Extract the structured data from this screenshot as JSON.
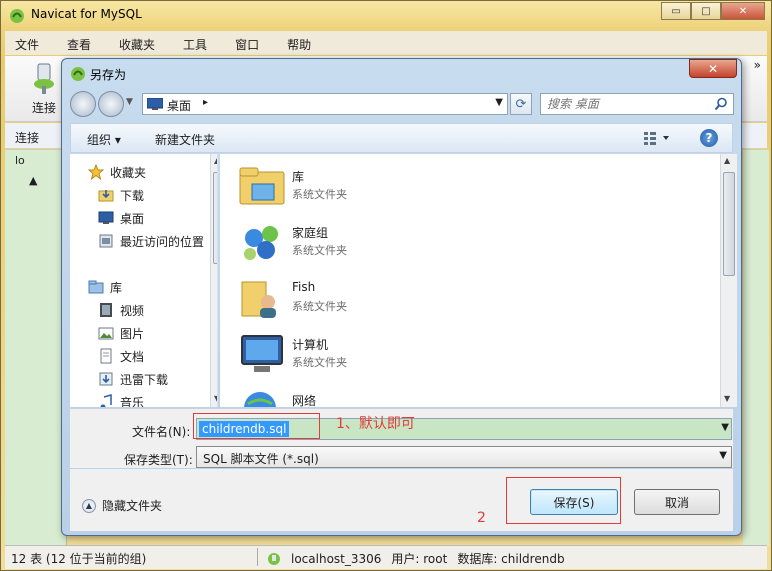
{
  "main_window": {
    "title": "Navicat for MySQL",
    "menu": [
      "文件",
      "查看",
      "收藏夹",
      "工具",
      "窗口",
      "帮助"
    ],
    "toolbar_connect": "连接",
    "more_chevron": "»",
    "subbar_label": "连接",
    "tree_items": [
      "lo",
      "▲"
    ],
    "status_left": "12 表 (12 位于当前的组)",
    "status_host": "localhost_3306",
    "status_user": "用户: root",
    "status_db": "数据库: childrendb",
    "controls": {
      "minimize": "▭",
      "maximize": "□",
      "close": "✕"
    }
  },
  "dialog": {
    "title": "另存为",
    "close": "✕",
    "address": {
      "location": "桌面",
      "separator": "▸"
    },
    "search_placeholder": "搜索 桌面",
    "toolbar": {
      "organize": "组织 ▾",
      "new_folder": "新建文件夹",
      "help": "?"
    },
    "nav": {
      "favorites_header": "收藏夹",
      "favorites": [
        "下载",
        "桌面",
        "最近访问的位置"
      ],
      "libraries_header": "库",
      "libraries": [
        "视频",
        "图片",
        "文档",
        "迅雷下载",
        "音乐"
      ]
    },
    "files": [
      {
        "name": "库",
        "type": "系统文件夹",
        "icon": "library-icon"
      },
      {
        "name": "家庭组",
        "type": "系统文件夹",
        "icon": "homegroup-icon"
      },
      {
        "name": "Fish",
        "type": "系统文件夹",
        "icon": "user-folder-icon"
      },
      {
        "name": "计算机",
        "type": "系统文件夹",
        "icon": "computer-icon"
      },
      {
        "name": "网络",
        "type": "",
        "icon": "network-icon"
      }
    ],
    "filename_label": "文件名(N):",
    "filename_value": "childrendb.sql",
    "filetype_label": "保存类型(T):",
    "filetype_value": "SQL 脚本文件 (*.sql)",
    "hide_folders": "隐藏文件夹",
    "save_button": "保存(S)",
    "cancel_button": "取消"
  },
  "annotations": {
    "step1": "1、默认即可",
    "step2": "2"
  },
  "colors": {
    "annotation": "#e23b3b",
    "selection": "#3399ff",
    "filename_bg": "#c9e6c4"
  }
}
